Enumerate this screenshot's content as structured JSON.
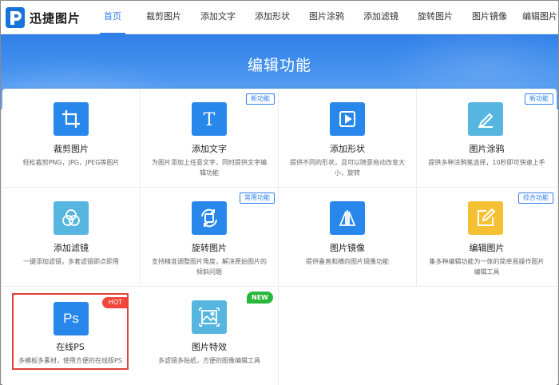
{
  "logo": {
    "text": "迅捷图片"
  },
  "nav": {
    "items": [
      "首页",
      "裁剪图片",
      "添加文字",
      "添加形状",
      "图片涂鸦",
      "添加滤镜",
      "旋转图片",
      "图片镜像",
      "编辑图片"
    ]
  },
  "banner": {
    "title": "编辑功能"
  },
  "cards": [
    {
      "title": "裁剪图片",
      "desc": "轻松裁剪PNG，JPG，JPEG等图片",
      "badge": "",
      "icon": "crop-icon"
    },
    {
      "title": "添加文字",
      "desc": "为图片添加上任意文字，同时提供文字编辑功能",
      "badge": "新功能",
      "icon": "text-icon"
    },
    {
      "title": "添加形状",
      "desc": "提供不同的形状，且可以随意拖动改变大小，旋转",
      "badge": "",
      "icon": "play-shape-icon"
    },
    {
      "title": "图片涂鸦",
      "desc": "提供多种涂鸦笔选择，10秒即可快速上手",
      "badge": "新功能",
      "icon": "pen-icon"
    },
    {
      "title": "添加滤镜",
      "desc": "一键添加滤镜，多套滤镜即点即用",
      "badge": "",
      "icon": "filter-icon"
    },
    {
      "title": "旋转图片",
      "desc": "支持精准调整图片角度，解决原始图片的倾斜问题",
      "badge": "常用功能",
      "icon": "rotate-icon"
    },
    {
      "title": "图片镜像",
      "desc": "提供垂直和横向图片镜像功能",
      "badge": "",
      "icon": "mirror-icon"
    },
    {
      "title": "编辑图片",
      "desc": "集多种编辑功能为一体的简单易操作图片编辑工具",
      "badge": "综合功能",
      "icon": "edit-icon"
    },
    {
      "title": "在线PS",
      "desc": "多模板多素材，使用方便的在线版PS",
      "badge": "HOT",
      "icon": "ps-icon"
    },
    {
      "title": "图片特效",
      "desc": "多滤镜多贴纸，方便的图像编辑工具",
      "badge": "NEW",
      "icon": "image-effect-icon"
    }
  ],
  "ps_icon_text": "Ps",
  "colors": {
    "accent": "#2f80ed",
    "banner": "#3d8bee",
    "hot": "#f2463c",
    "new": "#27b83b",
    "selected_border": "#e0403a",
    "icon_blue": "#2787ea",
    "icon_teal": "#56b6e0",
    "icon_yellow": "#f6c034"
  }
}
